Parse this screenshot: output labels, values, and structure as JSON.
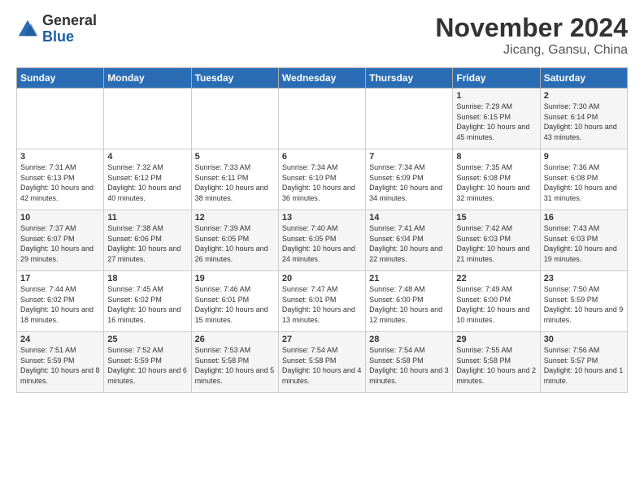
{
  "logo": {
    "general": "General",
    "blue": "Blue"
  },
  "title": "November 2024",
  "location": "Jicang, Gansu, China",
  "weekdays": [
    "Sunday",
    "Monday",
    "Tuesday",
    "Wednesday",
    "Thursday",
    "Friday",
    "Saturday"
  ],
  "weeks": [
    [
      {
        "day": "",
        "info": ""
      },
      {
        "day": "",
        "info": ""
      },
      {
        "day": "",
        "info": ""
      },
      {
        "day": "",
        "info": ""
      },
      {
        "day": "",
        "info": ""
      },
      {
        "day": "1",
        "info": "Sunrise: 7:29 AM\nSunset: 6:15 PM\nDaylight: 10 hours\nand 45 minutes."
      },
      {
        "day": "2",
        "info": "Sunrise: 7:30 AM\nSunset: 6:14 PM\nDaylight: 10 hours\nand 43 minutes."
      }
    ],
    [
      {
        "day": "3",
        "info": "Sunrise: 7:31 AM\nSunset: 6:13 PM\nDaylight: 10 hours\nand 42 minutes."
      },
      {
        "day": "4",
        "info": "Sunrise: 7:32 AM\nSunset: 6:12 PM\nDaylight: 10 hours\nand 40 minutes."
      },
      {
        "day": "5",
        "info": "Sunrise: 7:33 AM\nSunset: 6:11 PM\nDaylight: 10 hours\nand 38 minutes."
      },
      {
        "day": "6",
        "info": "Sunrise: 7:34 AM\nSunset: 6:10 PM\nDaylight: 10 hours\nand 36 minutes."
      },
      {
        "day": "7",
        "info": "Sunrise: 7:34 AM\nSunset: 6:09 PM\nDaylight: 10 hours\nand 34 minutes."
      },
      {
        "day": "8",
        "info": "Sunrise: 7:35 AM\nSunset: 6:08 PM\nDaylight: 10 hours\nand 32 minutes."
      },
      {
        "day": "9",
        "info": "Sunrise: 7:36 AM\nSunset: 6:08 PM\nDaylight: 10 hours\nand 31 minutes."
      }
    ],
    [
      {
        "day": "10",
        "info": "Sunrise: 7:37 AM\nSunset: 6:07 PM\nDaylight: 10 hours\nand 29 minutes."
      },
      {
        "day": "11",
        "info": "Sunrise: 7:38 AM\nSunset: 6:06 PM\nDaylight: 10 hours\nand 27 minutes."
      },
      {
        "day": "12",
        "info": "Sunrise: 7:39 AM\nSunset: 6:05 PM\nDaylight: 10 hours\nand 26 minutes."
      },
      {
        "day": "13",
        "info": "Sunrise: 7:40 AM\nSunset: 6:05 PM\nDaylight: 10 hours\nand 24 minutes."
      },
      {
        "day": "14",
        "info": "Sunrise: 7:41 AM\nSunset: 6:04 PM\nDaylight: 10 hours\nand 22 minutes."
      },
      {
        "day": "15",
        "info": "Sunrise: 7:42 AM\nSunset: 6:03 PM\nDaylight: 10 hours\nand 21 minutes."
      },
      {
        "day": "16",
        "info": "Sunrise: 7:43 AM\nSunset: 6:03 PM\nDaylight: 10 hours\nand 19 minutes."
      }
    ],
    [
      {
        "day": "17",
        "info": "Sunrise: 7:44 AM\nSunset: 6:02 PM\nDaylight: 10 hours\nand 18 minutes."
      },
      {
        "day": "18",
        "info": "Sunrise: 7:45 AM\nSunset: 6:02 PM\nDaylight: 10 hours\nand 16 minutes."
      },
      {
        "day": "19",
        "info": "Sunrise: 7:46 AM\nSunset: 6:01 PM\nDaylight: 10 hours\nand 15 minutes."
      },
      {
        "day": "20",
        "info": "Sunrise: 7:47 AM\nSunset: 6:01 PM\nDaylight: 10 hours\nand 13 minutes."
      },
      {
        "day": "21",
        "info": "Sunrise: 7:48 AM\nSunset: 6:00 PM\nDaylight: 10 hours\nand 12 minutes."
      },
      {
        "day": "22",
        "info": "Sunrise: 7:49 AM\nSunset: 6:00 PM\nDaylight: 10 hours\nand 10 minutes."
      },
      {
        "day": "23",
        "info": "Sunrise: 7:50 AM\nSunset: 5:59 PM\nDaylight: 10 hours\nand 9 minutes."
      }
    ],
    [
      {
        "day": "24",
        "info": "Sunrise: 7:51 AM\nSunset: 5:59 PM\nDaylight: 10 hours\nand 8 minutes."
      },
      {
        "day": "25",
        "info": "Sunrise: 7:52 AM\nSunset: 5:59 PM\nDaylight: 10 hours\nand 6 minutes."
      },
      {
        "day": "26",
        "info": "Sunrise: 7:53 AM\nSunset: 5:58 PM\nDaylight: 10 hours\nand 5 minutes."
      },
      {
        "day": "27",
        "info": "Sunrise: 7:54 AM\nSunset: 5:58 PM\nDaylight: 10 hours\nand 4 minutes."
      },
      {
        "day": "28",
        "info": "Sunrise: 7:54 AM\nSunset: 5:58 PM\nDaylight: 10 hours\nand 3 minutes."
      },
      {
        "day": "29",
        "info": "Sunrise: 7:55 AM\nSunset: 5:58 PM\nDaylight: 10 hours\nand 2 minutes."
      },
      {
        "day": "30",
        "info": "Sunrise: 7:56 AM\nSunset: 5:57 PM\nDaylight: 10 hours\nand 1 minute."
      }
    ]
  ]
}
